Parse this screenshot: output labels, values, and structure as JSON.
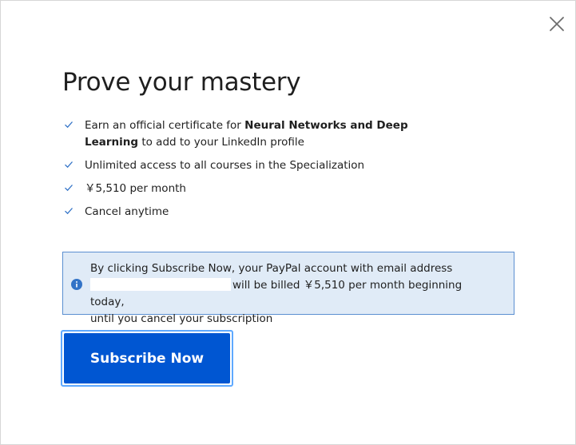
{
  "modal": {
    "title": "Prove your mastery",
    "close_icon": "close-icon"
  },
  "benefits": [
    {
      "pre": "Earn an official certificate for ",
      "bold": "Neural Networks and Deep Learning",
      "post": " to add to your LinkedIn profile"
    },
    {
      "text": "Unlimited access to all courses in the Specialization"
    },
    {
      "text": "￥5,510 per month"
    },
    {
      "text": "Cancel anytime"
    }
  ],
  "notice": {
    "icon": "info-icon",
    "line1": "By clicking Subscribe Now, your PayPal account with email address",
    "line2": "will be billed ￥5,510 per month beginning today,",
    "line3": "until you cancel your subscription"
  },
  "cta": {
    "label": "Subscribe Now"
  },
  "colors": {
    "primary": "#0056d2",
    "check": "#3273c7",
    "notice_bg": "#e0ebf7",
    "notice_border": "#5b8fd1",
    "focus_ring": "#5ea9ff"
  }
}
